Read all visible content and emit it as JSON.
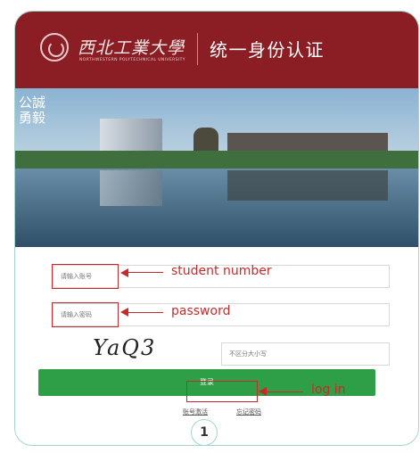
{
  "header": {
    "school_name": "西北工業大學",
    "school_sub": "NORTHWESTERN POLYTECHNICAL UNIVERSITY",
    "system_title": "统一身份认证"
  },
  "banner": {
    "motto": "公誠勇毅"
  },
  "form": {
    "username_placeholder": "请输入账号",
    "password_placeholder": "请输入密码",
    "captcha_text": "YaQ3",
    "captcha_placeholder": "不区分大小写",
    "login_label": "登录"
  },
  "links": {
    "activate": "账号激活",
    "forgot": "忘记密码"
  },
  "annotations": {
    "student_number": "student number",
    "password": "password",
    "log_in": "log in"
  },
  "figure_number": "1",
  "colors": {
    "header": "#8a1e24",
    "button": "#2e9f47",
    "annotation": "#c62b2b",
    "frame": "#9fd7cf"
  }
}
